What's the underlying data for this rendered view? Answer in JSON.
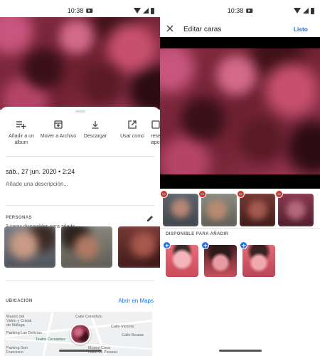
{
  "status": {
    "time": "10:38"
  },
  "left": {
    "actions": [
      {
        "label": "Añadir a un álbum",
        "icon": "add-to-playlist-icon"
      },
      {
        "label": "Mover a Archivo",
        "icon": "archive-icon"
      },
      {
        "label": "Descargar",
        "icon": "download-icon"
      },
      {
        "label": "Usar como",
        "icon": "open-external-icon"
      },
      {
        "label": "Presentación diapositivas",
        "icon": "slideshow-icon"
      }
    ],
    "date": "sáb., 27 jun. 2020  •  2:24",
    "description_placeholder": "Añade una descripción...",
    "people_label": "PERSONAS",
    "faces_available": "3 caras disponibles para añadir",
    "location_label": "UBICACIÓN",
    "maps_link": "Abrir en Maps",
    "map_labels": [
      "Museo del\nVidrio y Cristal\nde Málaga",
      "Parking Las Delicias",
      "Teatro Cervantes",
      "Parking San\nFrancisco",
      "Museo Casa\nNatal de Picasso",
      "Calle Victoria",
      "Calle Cobertizo",
      "Calle Beatas"
    ]
  },
  "right": {
    "title": "Editar caras",
    "done": "Listo",
    "available_label": "DISPONIBLE PARA AÑADIR"
  },
  "colors": {
    "accent": "#1a73e8",
    "remove": "#d93025",
    "photo_red": "#8e2f47"
  }
}
